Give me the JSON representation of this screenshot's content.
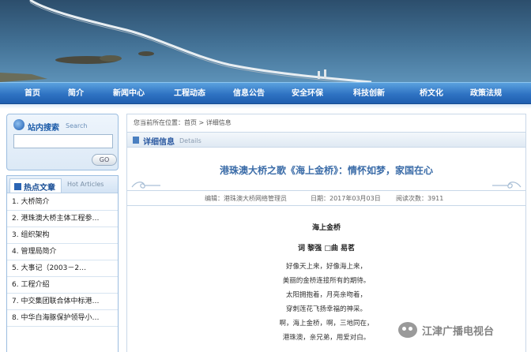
{
  "nav": {
    "items": [
      "首页",
      "简介",
      "新闻中心",
      "工程动态",
      "信息公告",
      "安全环保",
      "科技创新",
      "桥文化",
      "政策法规"
    ]
  },
  "search": {
    "title": "站内搜索",
    "title_en": "Search",
    "value": "",
    "placeholder": "",
    "button_label": "GO"
  },
  "hot_articles": {
    "title": "热点文章",
    "title_en": "Hot Articles",
    "items": [
      "1. 大桥简介",
      "2. 港珠澳大桥主体工程参…",
      "3. 组织架构",
      "4. 管理局简介",
      "5. 大事记（2003－2…",
      "6. 工程介绍",
      "7. 中交集团联合体中标港…",
      "8. 中华白海豚保护领导小…"
    ]
  },
  "breadcrumb": {
    "prefix": "您当前所在位置：",
    "home": "首页",
    "separator": ">",
    "current": "详细信息"
  },
  "detail": {
    "title": "详细信息",
    "title_en": "Details"
  },
  "article": {
    "title": "港珠澳大桥之歌《海上金桥》：情怀如梦，家国在心",
    "editor": "编辑：港珠澳大桥网络管理员",
    "date": "日期：2017年03月03日",
    "views": "阅读次数：3911",
    "poem_title": "海上金桥",
    "poem_author": "词 黎强 □曲 易茗",
    "poem_lines": [
      "好像天上来，好像海上来，",
      "美丽的金桥连接所有的期待。",
      "太阳拥抱着，月亮亲吻着，",
      "穿刺莲花飞扬幸福的神采。",
      "啊，海上金桥，啊，三地同在，",
      "港珠澳，亲兄弟，用爱对白。"
    ]
  },
  "watermark": {
    "text": "江津广播电视台"
  },
  "colors": {
    "nav_blue": "#2f73c3",
    "title_blue": "#3b6ca8",
    "border_blue": "#9bbde0"
  }
}
